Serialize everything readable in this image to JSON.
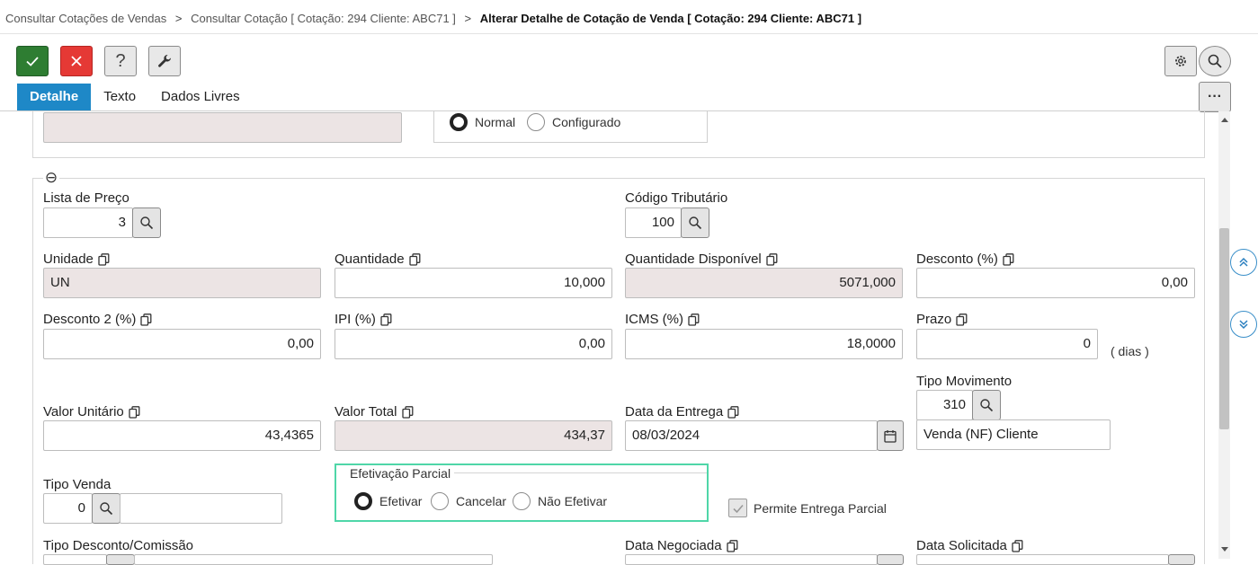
{
  "breadcrumb": {
    "items": [
      "Consultar Cotações de Vendas",
      "Consultar Cotação [ Cotação: 294 Cliente: ABC71 ]"
    ],
    "current": "Alterar Detalhe de Cotação de Venda [ Cotação: 294 Cliente: ABC71 ]",
    "separator": ">"
  },
  "toolbar": {
    "confirm_icon": "check-icon",
    "cancel_icon": "close-icon",
    "help_label": "?",
    "tools_icon": "wrench-icon",
    "settings_icon": "gear-icon",
    "search_icon": "search-icon",
    "more_label": "···"
  },
  "tabs": [
    {
      "label": "Detalhe",
      "active": true
    },
    {
      "label": "Texto",
      "active": false
    },
    {
      "label": "Dados Livres",
      "active": false
    }
  ],
  "top_section": {
    "radio_options": [
      {
        "label": "Normal",
        "selected": true
      },
      {
        "label": "Configurado",
        "selected": false
      }
    ]
  },
  "collapse_label": "⊖",
  "form": {
    "lista_preco": {
      "label": "Lista de Preço",
      "value": "3"
    },
    "codigo_tributario": {
      "label": "Código Tributário",
      "value": "100"
    },
    "unidade": {
      "label": "Unidade",
      "value": "UN"
    },
    "quantidade": {
      "label": "Quantidade",
      "value": "10,000"
    },
    "quantidade_disponivel": {
      "label": "Quantidade Disponível",
      "value": "5071,000"
    },
    "desconto": {
      "label": "Desconto (%)",
      "value": "0,00"
    },
    "desconto2": {
      "label": "Desconto 2 (%)",
      "value": "0,00"
    },
    "ipi": {
      "label": "IPI (%)",
      "value": "0,00"
    },
    "icms": {
      "label": "ICMS (%)",
      "value": "18,0000"
    },
    "prazo": {
      "label": "Prazo",
      "value": "0",
      "suffix": "( dias )"
    },
    "tipo_movimento": {
      "label": "Tipo Movimento",
      "value": "310",
      "description": "Venda (NF) Cliente"
    },
    "valor_unitario": {
      "label": "Valor Unitário",
      "value": "43,4365"
    },
    "valor_total": {
      "label": "Valor Total",
      "value": "434,37"
    },
    "data_entrega": {
      "label": "Data da Entrega",
      "value": "08/03/2024"
    },
    "tipo_venda": {
      "label": "Tipo Venda",
      "value": "0",
      "description": ""
    },
    "efetivacao_parcial": {
      "label": "Efetivação Parcial",
      "options": [
        {
          "label": "Efetivar",
          "selected": true
        },
        {
          "label": "Cancelar",
          "selected": false
        },
        {
          "label": "Não Efetivar",
          "selected": false
        }
      ]
    },
    "permite_entrega_parcial": {
      "label": "Permite Entrega Parcial",
      "checked": true
    },
    "tipo_desconto_comissao": {
      "label": "Tipo Desconto/Comissão"
    },
    "data_negociada": {
      "label": "Data Negociada"
    },
    "data_solicitada": {
      "label": "Data Solicitada"
    }
  },
  "colors": {
    "accent": "#1e88c7",
    "confirm": "#2e7d32",
    "cancel": "#e53935",
    "readonly_bg": "#ece4e4",
    "focus_border": "#4fd6a8"
  }
}
